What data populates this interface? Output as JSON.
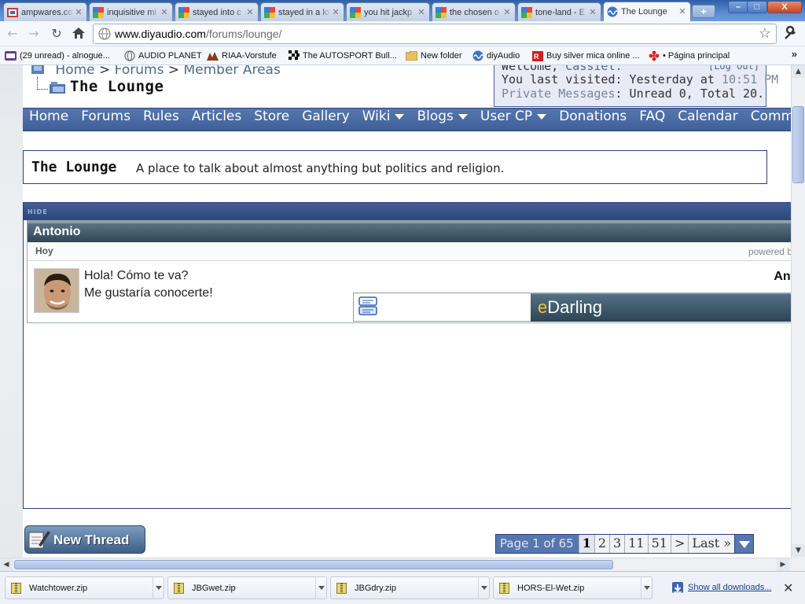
{
  "browser": {
    "tabs": [
      {
        "title": "ampwares.co",
        "icon": "ampwares-icon"
      },
      {
        "title": "inquisitive mi",
        "icon": "google-icon"
      },
      {
        "title": "stayed into c",
        "icon": "google-icon"
      },
      {
        "title": "stayed in a lo",
        "icon": "google-icon"
      },
      {
        "title": "you hit jackp",
        "icon": "google-icon"
      },
      {
        "title": "the chosen o",
        "icon": "google-icon"
      },
      {
        "title": "tone-land - E",
        "icon": "google-icon"
      },
      {
        "title": "The Lounge",
        "icon": "diyaudio-icon",
        "active": true
      }
    ],
    "new_tab": "+",
    "window_buttons": {
      "minimize": "–",
      "maximize": "□",
      "close": "X"
    },
    "url_host": "www.diyaudio.com",
    "url_path": "/forums/lounge/",
    "bookmarks": [
      {
        "label": "(29 unread) - alnogue...",
        "icon": "mail-icon"
      },
      {
        "label": "AUDIO PLANET",
        "icon": "globe-icon"
      },
      {
        "label": "RIAA-Vorstufe",
        "icon": "riaa-icon"
      },
      {
        "label": "The AUTOSPORT Bull...",
        "icon": "checkered-flag-icon"
      },
      {
        "label": "New folder",
        "icon": "folder-icon"
      },
      {
        "label": "diyAudio",
        "icon": "diyaudio-icon"
      },
      {
        "label": "Buy silver mica online ...",
        "icon": "rs-icon"
      },
      {
        "label": "• Página principal",
        "icon": "flower-icon"
      }
    ],
    "bookmarks_more": "»"
  },
  "header": {
    "breadcrumbs": [
      "Home",
      "Forums",
      "Member Areas"
    ],
    "breadcrumb_sep": ">",
    "current_forum": "The Lounge",
    "welcome_prefix": "Welcome,",
    "username": "Cassiel.",
    "logout": "[Log Out]",
    "last_visited_prefix": "You last visited: Yesterday at",
    "last_visited_time": "10:51 PM",
    "pm_link": "Private Messages",
    "pm_status": ": Unread 0, Total 20."
  },
  "navbar": {
    "items": [
      {
        "label": "Home",
        "dropdown": false
      },
      {
        "label": "Forums",
        "dropdown": false
      },
      {
        "label": "Rules",
        "dropdown": false
      },
      {
        "label": "Articles",
        "dropdown": false
      },
      {
        "label": "Store",
        "dropdown": false
      },
      {
        "label": "Gallery",
        "dropdown": false
      },
      {
        "label": "Wiki",
        "dropdown": true
      },
      {
        "label": "Blogs",
        "dropdown": true
      },
      {
        "label": "User CP",
        "dropdown": true
      },
      {
        "label": "Donations",
        "dropdown": false
      },
      {
        "label": "FAQ",
        "dropdown": false
      },
      {
        "label": "Calendar",
        "dropdown": false
      },
      {
        "label": "Commun",
        "dropdown": false
      }
    ]
  },
  "forum_info": {
    "title": "The Lounge",
    "description": "A place to talk about almost anything but politics and religion."
  },
  "ad": {
    "hide_label": "HIDE",
    "chat_name": "Antonio",
    "day": "Hoy",
    "powered_by": "powered b",
    "message_line1": "Hola! Cómo te va?",
    "message_line2": "Me gustaría conocerte!",
    "right_name": "Ant",
    "brand_e": "e",
    "brand_rest": "Darling"
  },
  "thread_controls": {
    "new_thread_label": "New Thread",
    "page_label": "Page 1 of 65",
    "pages": [
      "1",
      "2",
      "3",
      "11",
      "51",
      ">",
      "Last »"
    ],
    "current_page": "1"
  },
  "downloads": {
    "items": [
      "Watchtower.zip",
      "JBGwet.zip",
      "JBGdry.zip",
      "HORS-El-Wet.zip"
    ],
    "show_all": "Show all downloads...",
    "close": "✕"
  },
  "colors": {
    "accent_blue": "#5677ae",
    "link_gray_blue": "#4a6a8e",
    "chat_header": "#2f4655",
    "edarling_yellow": "#f2c230"
  }
}
